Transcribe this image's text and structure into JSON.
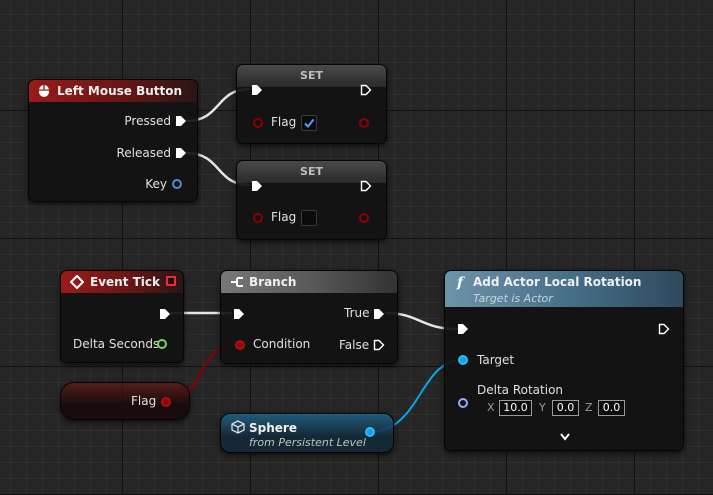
{
  "colors": {
    "exec": "#ffffff",
    "bool": "#8c0000",
    "float": "#7ad35b",
    "object": "#0ba4e8",
    "struct": "#9aa8ff",
    "event_header": "#9a1b1b",
    "function_header": "#6d93aa"
  },
  "left_mouse": {
    "title": "Left Mouse Button",
    "icon": "mouse-icon",
    "pressed": "Pressed",
    "released": "Released",
    "key": "Key"
  },
  "set1": {
    "title": "SET",
    "flag": "Flag",
    "checked": true
  },
  "set2": {
    "title": "SET",
    "flag": "Flag",
    "checked": false
  },
  "event_tick": {
    "title": "Event Tick",
    "delta": "Delta Seconds"
  },
  "branch": {
    "title": "Branch",
    "condition": "Condition",
    "true_label": "True",
    "false_label": "False"
  },
  "flag_getter": {
    "label": "Flag"
  },
  "sphere": {
    "title": "Sphere",
    "subtitle": "from Persistent Level"
  },
  "add_rot": {
    "title": "Add Actor Local Rotation",
    "subtitle": "Target is Actor",
    "target": "Target",
    "delta_rotation": "Delta Rotation",
    "x_label": "X",
    "x": "10.0",
    "y_label": "Y",
    "y": "0.0",
    "z_label": "Z",
    "z": "0.0",
    "func_icon": "f",
    "expand_icon": "chevron-down-icon"
  }
}
